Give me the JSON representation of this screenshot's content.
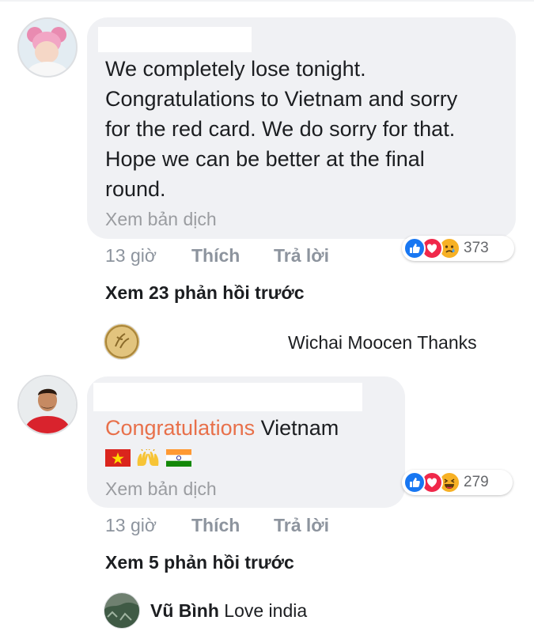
{
  "comments": [
    {
      "text": "We completely lose tonight. Congratulations to Vietnam and sorry for the red card. We do sorry for that. Hope we can be better at the final round.",
      "lines": [
        "We completely lose tonight.",
        "Congratulations to Vietnam and sorry",
        "for the red card. We do sorry for that.",
        "Hope we can be better at the final",
        "round."
      ],
      "translate_label": "Xem bản dịch",
      "time": "13 giờ",
      "like_label": "Thích",
      "reply_label": "Trả lời",
      "reactions": [
        "like-icon",
        "love-icon",
        "sad-icon"
      ],
      "reaction_count": "373",
      "more_replies": "Xem 23 phản hồi trước",
      "reply": {
        "name": "Wichai Moocen",
        "text": "Thanks"
      }
    },
    {
      "highlight_word": "Congratulations",
      "rest_text": "Vietnam",
      "emoji": [
        "vietnam-flag-icon",
        "raised-hands-icon",
        "india-flag-icon"
      ],
      "translate_label": "Xem bản dịch",
      "time": "13 giờ",
      "like_label": "Thích",
      "reply_label": "Trả lời",
      "reactions": [
        "like-icon",
        "love-icon",
        "haha-icon"
      ],
      "reaction_count": "279",
      "more_replies": "Xem 5 phản hồi trước",
      "reply": {
        "name": "Vũ Bình",
        "text": "Love india"
      }
    }
  ],
  "colors": {
    "bubble": "#f0f1f4",
    "highlight": "#e8704a",
    "like_blue": "#1877f2",
    "love_red": "#f0284a",
    "emoji_yellow": "#f7b125"
  }
}
